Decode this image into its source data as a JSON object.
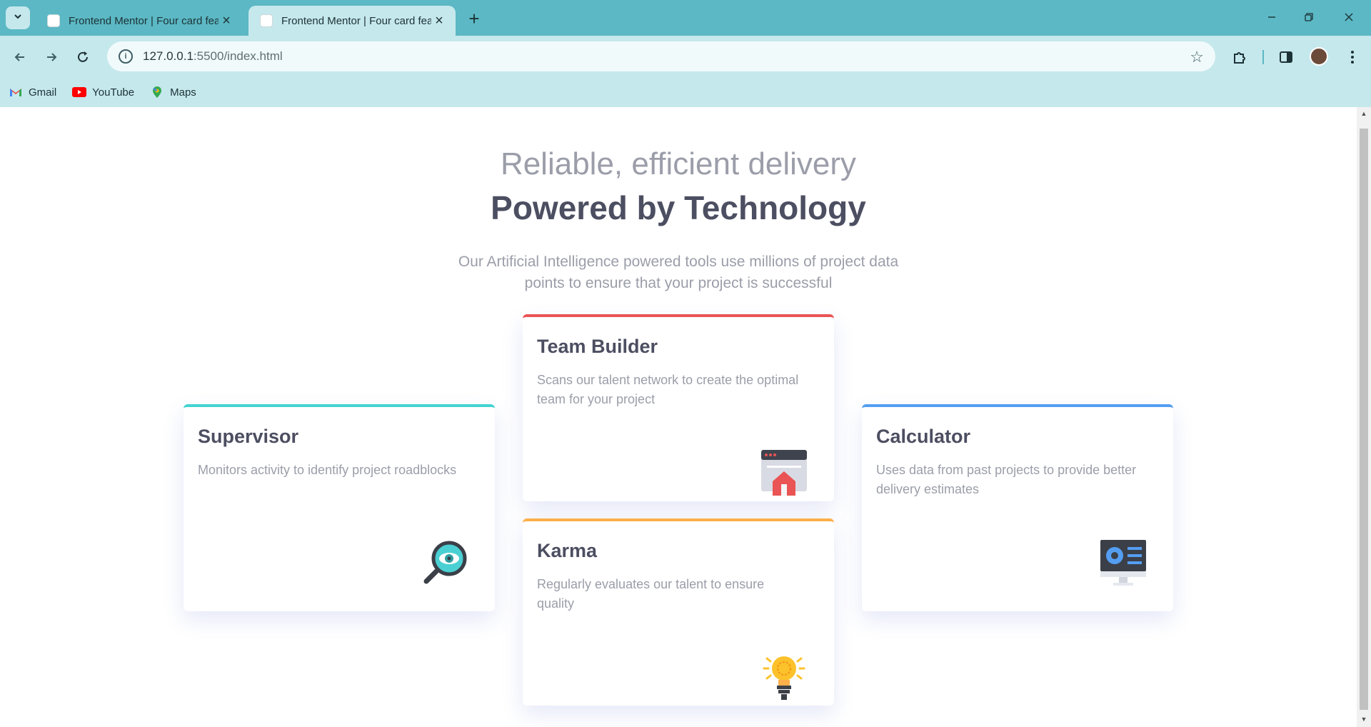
{
  "browser": {
    "tabs": [
      {
        "title": "Frontend Mentor | Four card feature section",
        "active": false
      },
      {
        "title": "Frontend Mentor | Four card feature section",
        "active": true
      }
    ],
    "url_host": "127.0.0.1",
    "url_rest": ":5500/index.html",
    "bookmarks": [
      "Gmail",
      "YouTube",
      "Maps"
    ]
  },
  "hero": {
    "subtitle": "Reliable, efficient delivery",
    "title": "Powered by Technology",
    "description": "Our Artificial Intelligence powered tools use millions of project data points to ensure that your project is successful"
  },
  "cards": {
    "supervisor": {
      "title": "Supervisor",
      "description": "Monitors activity to identify project roadblocks",
      "icon": "magnifier-eye-icon",
      "accent": "#44d3d2"
    },
    "team_builder": {
      "title": "Team Builder",
      "description": "Scans our talent network to create the optimal team for your project",
      "icon": "team-builder-icon",
      "accent": "#ea5454"
    },
    "karma": {
      "title": "Karma",
      "description": "Regularly evaluates our talent to ensure quality",
      "icon": "lightbulb-icon",
      "accent": "#fcaf4a"
    },
    "calculator": {
      "title": "Calculator",
      "description": "Uses data from past projects to provide better delivery estimates",
      "icon": "calculator-monitor-icon",
      "accent": "#549ef2"
    }
  },
  "colors": {
    "chrome_tabstrip": "#5bb8c4",
    "chrome_toolbar": "#c5e8ec",
    "heading_dark": "#4c4e61",
    "text_grey": "#9b9ea9"
  }
}
